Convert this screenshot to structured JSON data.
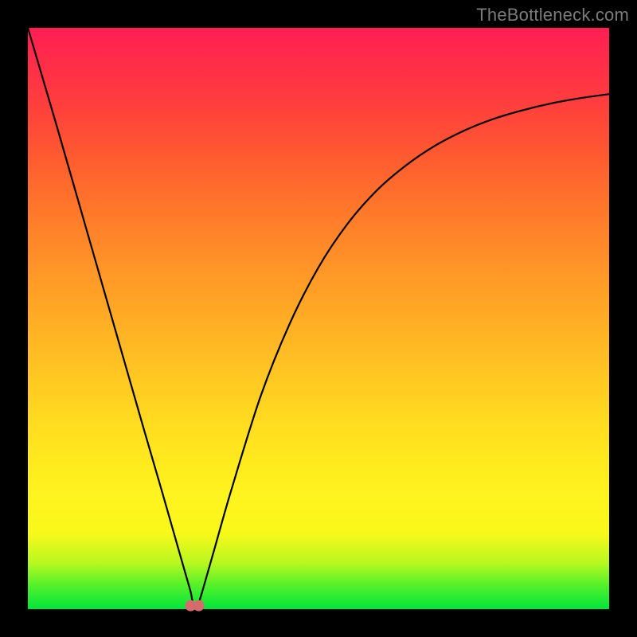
{
  "watermark": "TheBottleneck.com",
  "chart_data": {
    "type": "line",
    "title": "",
    "xlabel": "",
    "ylabel": "",
    "xlim": [
      0,
      1
    ],
    "ylim": [
      0,
      1
    ],
    "grid": false,
    "legend": false,
    "series": [
      {
        "name": "bottleneck-curve",
        "x": [
          0.0,
          0.05,
          0.1,
          0.15,
          0.2,
          0.23,
          0.26,
          0.27,
          0.28,
          0.283,
          0.287,
          0.29,
          0.3,
          0.32,
          0.35,
          0.4,
          0.45,
          0.5,
          0.55,
          0.6,
          0.65,
          0.7,
          0.75,
          0.8,
          0.85,
          0.9,
          0.95,
          1.0
        ],
        "y": [
          1.0,
          0.83,
          0.656,
          0.482,
          0.308,
          0.205,
          0.1,
          0.065,
          0.03,
          0.015,
          0.005,
          0.0,
          0.03,
          0.1,
          0.205,
          0.365,
          0.49,
          0.588,
          0.663,
          0.72,
          0.763,
          0.797,
          0.823,
          0.843,
          0.858,
          0.87,
          0.879,
          0.886
        ],
        "color": "#000000"
      }
    ],
    "markers": [
      {
        "name": "optimum-dot-1",
        "x": 0.28,
        "y": 0.006,
        "color": "#d76a6a",
        "r": 7
      },
      {
        "name": "optimum-dot-2",
        "x": 0.294,
        "y": 0.006,
        "color": "#d76a6a",
        "r": 7
      }
    ]
  }
}
